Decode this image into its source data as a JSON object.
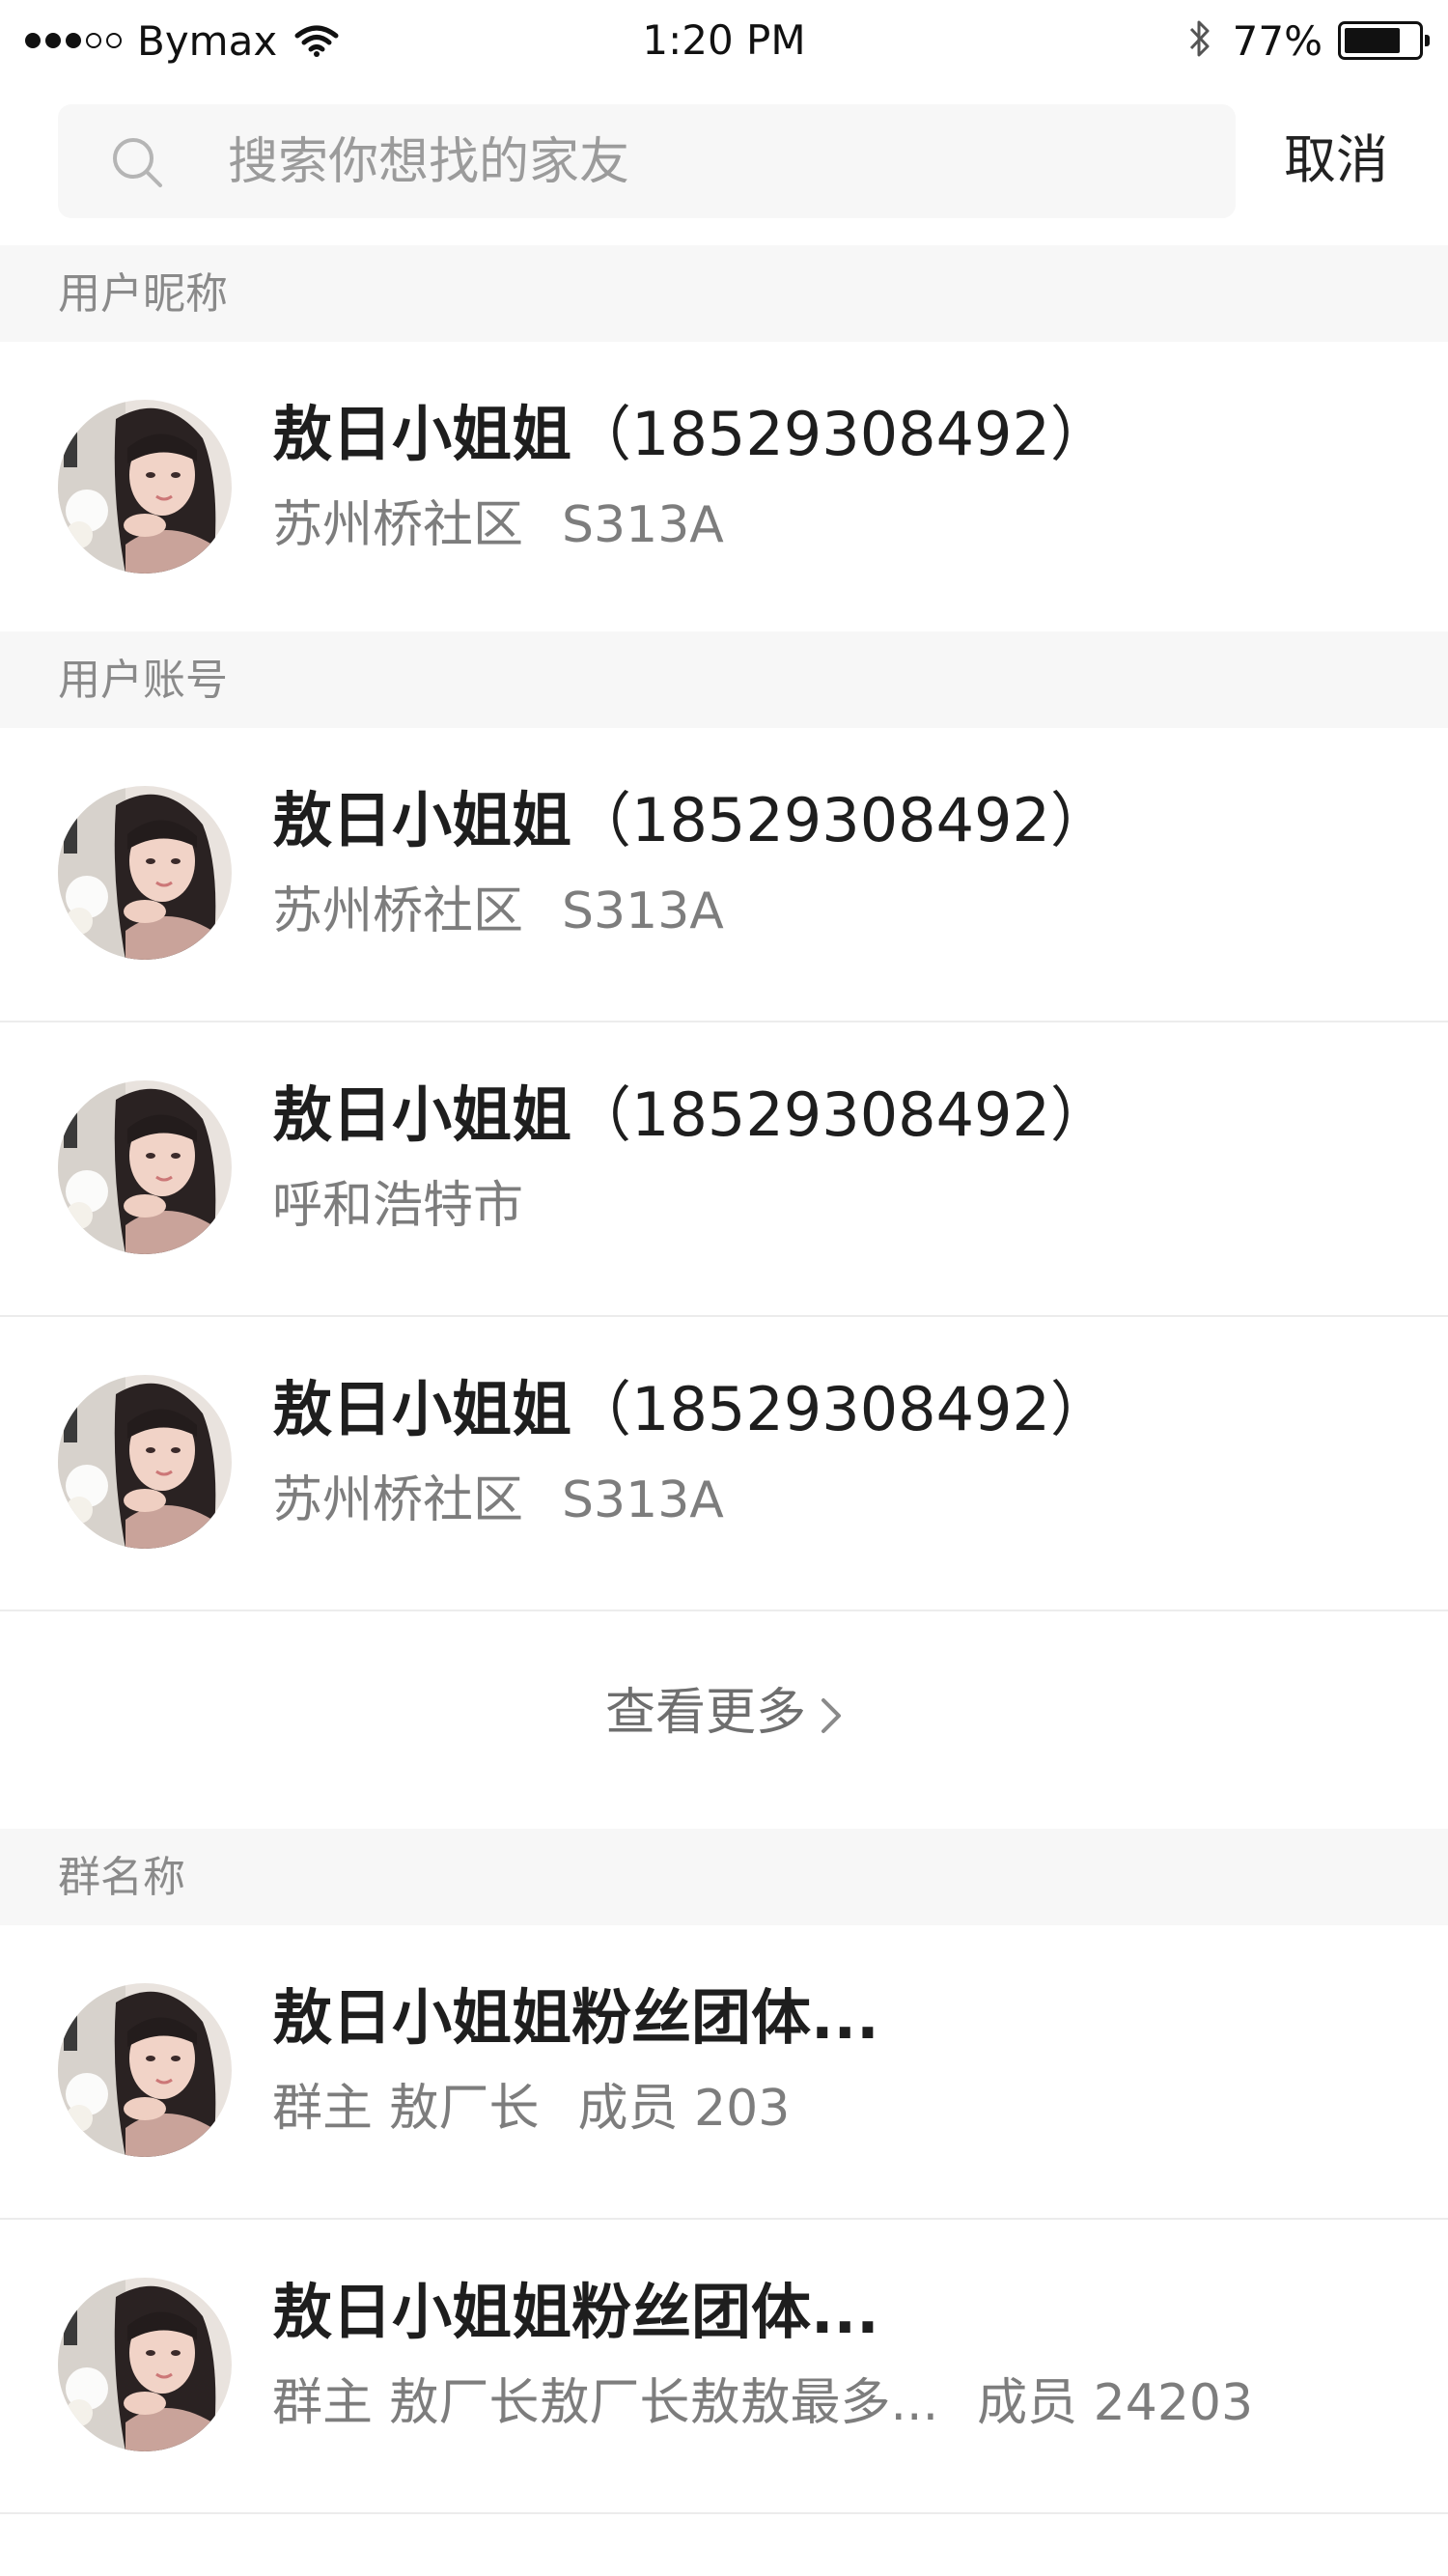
{
  "status_bar": {
    "carrier": "Bymax",
    "time": "1:20 PM",
    "battery_percent": "77%",
    "battery_level": 0.77,
    "signal_bars": 3,
    "signal_total": 5
  },
  "search": {
    "placeholder": "搜索你想找的家友",
    "cancel_label": "取消"
  },
  "sections": {
    "nickname": {
      "header": "用户昵称",
      "items": [
        {
          "name": "敖日小姐姐",
          "phone": "（18529308492）",
          "location": "苏州桥社区",
          "code": "S313A"
        }
      ]
    },
    "account": {
      "header": "用户账号",
      "items": [
        {
          "name": "敖日小姐姐",
          "phone": "（18529308492）",
          "location": "苏州桥社区",
          "code": "S313A"
        },
        {
          "name": "敖日小姐姐",
          "phone": "（18529308492）",
          "location": "呼和浩特市",
          "code": ""
        },
        {
          "name": "敖日小姐姐",
          "phone": "（18529308492）",
          "location": "苏州桥社区",
          "code": "S313A"
        }
      ],
      "more_label": "查看更多"
    },
    "groups": {
      "header": "群名称",
      "items": [
        {
          "name": "敖日小姐姐粉丝团体...",
          "owner": "群主 敖厂长",
          "members": "成员 203"
        },
        {
          "name": "敖日小姐姐粉丝团体...",
          "owner": "群主 敖厂长敖厂长敖敖最多...",
          "members": "成员 24203"
        }
      ]
    }
  },
  "colors": {
    "section_bg": "#f7f7f7",
    "title_text": "#1e1e1e",
    "secondary_text": "#7d7d7d",
    "divider": "#ececec"
  }
}
